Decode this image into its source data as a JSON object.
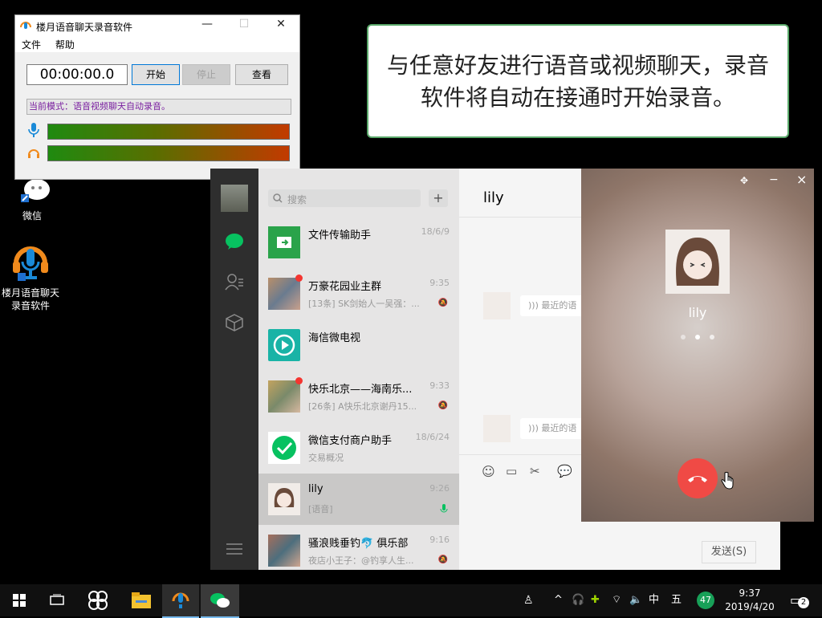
{
  "desktop": {
    "icons": [
      {
        "label": "微信"
      },
      {
        "label": "楼月语音聊天\n录音软件"
      }
    ]
  },
  "recorder": {
    "title": "楼月语音聊天录音软件",
    "menu": [
      "文件",
      "帮助"
    ],
    "time": "00:00:00.0",
    "start_label": "开始",
    "stop_label": "停止",
    "view_label": "查看",
    "mode_text": "当前模式：语音视频聊天自动录音。"
  },
  "tip": {
    "text": "与任意好友进行语音或视频聊天，录音软件将自动在接通时开始录音。"
  },
  "wechat": {
    "search_placeholder": "搜索",
    "add_label": "+",
    "chat_title": "lily",
    "items": [
      {
        "name": "文件传输助手",
        "time": "18/6/9",
        "sub": ""
      },
      {
        "name": "万豪花园业主群",
        "time": "9:35",
        "sub": "[13条] SK剑始人一吴强：..."
      },
      {
        "name": "海信微电视",
        "time": "",
        "sub": ""
      },
      {
        "name": "快乐北京——海南乐...",
        "time": "9:33",
        "sub": "[26条] A快乐北京谢丹15..."
      },
      {
        "name": "微信支付商户助手",
        "time": "18/6/24",
        "sub": "交易概况"
      },
      {
        "name": "lily",
        "time": "9:26",
        "sub": "[语音]"
      },
      {
        "name": "骚浪贱垂钓🐬 俱乐部",
        "time": "9:16",
        "sub": "夜店小王子：@钓享人生..."
      }
    ],
    "voice_msg_1": "最近的语",
    "voice_msg_2": "最近的语",
    "send_label": "发送(S)"
  },
  "call": {
    "name": "lily",
    "pin_label": "✥",
    "min_label": "−",
    "close_label": "×"
  },
  "taskbar": {
    "ime1": "中",
    "ime2": "五",
    "badge": "47",
    "time": "9:37",
    "date": "2019/4/20",
    "notif_count": "2"
  }
}
